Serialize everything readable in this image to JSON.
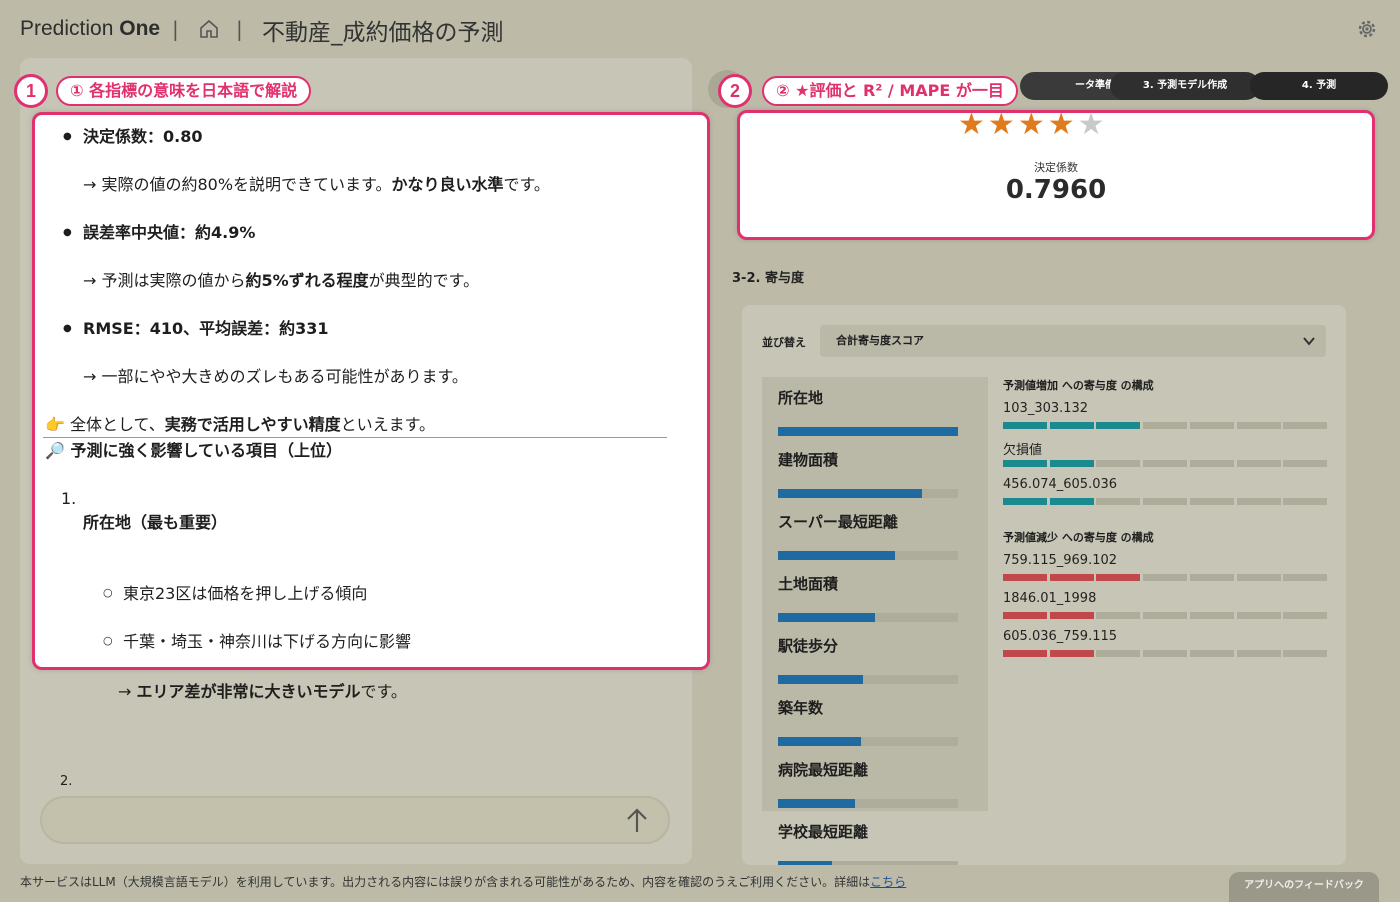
{
  "header": {
    "brand_light": "Prediction",
    "brand_bold": "One",
    "separator": "|",
    "title": "不動産_成約価格の予測"
  },
  "callouts": [
    {
      "number": "1",
      "label": "① 各指標の意味を日本語で解説"
    },
    {
      "number": "2",
      "label": "② ★評価と R² / MAPE が一目"
    }
  ],
  "chat": {
    "items": [
      {
        "label": "決定係数：0.80"
      },
      {
        "arrow": "→ 実際の値の約80%を説明できています。",
        "bold": "かなり良い水準",
        "tail": "です。"
      },
      {
        "label": "誤差率中央値：約4.9%"
      },
      {
        "arrow": "→ 予測は実際の値から",
        "bold": "約5%ずれる程度",
        "tail": "が典型的です。"
      },
      {
        "label": "RMSE：410、平均誤差：約331"
      },
      {
        "arrow": "→ 一部にやや大きめのズレもある可能性があります。"
      }
    ],
    "summary_pre": "全体として、",
    "summary_bold": "実務で活用しやすい精度",
    "summary_post": "といえます。",
    "summary_icon": "👉",
    "section_icon": "🔎",
    "section_heading": "予測に強く影響している項目（上位）",
    "ordered_num": "1.",
    "ordered_title": "所在地（最も重要）",
    "sub_items": [
      "東京23区は価格を押し上げる傾向",
      "千葉・埼玉・神奈川は下げる方向に影響"
    ],
    "below_arrow": "→ ",
    "below_bold": "エリア差が非常に大きいモデル",
    "below_tail": "です。",
    "next_num": "2."
  },
  "steps": [
    {
      "label": "ータ準備"
    },
    {
      "label": "3. 予測モデル作成"
    },
    {
      "label": "4. 予測"
    }
  ],
  "score": {
    "stars_filled": 4,
    "stars_total": 5,
    "label": "決定係数",
    "value": "0.7960"
  },
  "contribution": {
    "section_title": "3-2. 寄与度",
    "sort_label": "並び替え",
    "sort_value": "合計寄与度スコア",
    "features": [
      {
        "name": "所在地",
        "score": 1.0
      },
      {
        "name": "建物面積",
        "score": 0.8
      },
      {
        "name": "スーパー最短距離",
        "score": 0.65
      },
      {
        "name": "土地面積",
        "score": 0.54
      },
      {
        "name": "駅徒歩分",
        "score": 0.47
      },
      {
        "name": "築年数",
        "score": 0.46
      },
      {
        "name": "病院最短距離",
        "score": 0.43
      },
      {
        "name": "学校最短距離",
        "score": 0.3
      }
    ],
    "increase_title": "予測値増加 への寄与度 の構成",
    "increase": [
      {
        "label": "103_303.132",
        "filled": 3
      },
      {
        "label": "欠損値",
        "filled": 2
      },
      {
        "label": "456.074_605.036",
        "filled": 2
      }
    ],
    "decrease_title": "予測値減少 への寄与度 の構成",
    "decrease": [
      {
        "label": "759.115_969.102",
        "filled": 3
      },
      {
        "label": "1846.01_1998",
        "filled": 2
      },
      {
        "label": "605.036_759.115",
        "filled": 2
      }
    ],
    "colors": {
      "increase": "#1a8a8f",
      "decrease": "#c0474a",
      "empty": "#aeac9b",
      "feature_bar": "#1f6aa0"
    }
  },
  "footer": {
    "text": "本サービスはLLM（大規模言語モデル）を利用しています。出力される内容には誤りが含まれる可能性があるため、内容を確認のうえご利用ください。詳細は",
    "link": "こちら",
    "feedback": "アプリへのフィードバック"
  }
}
